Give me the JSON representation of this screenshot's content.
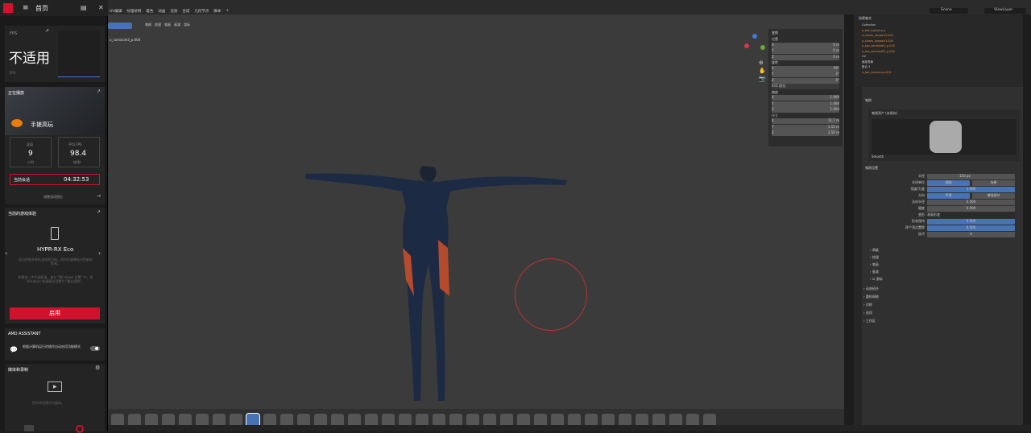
{
  "amd": {
    "title": "首页",
    "fps_label": "FPS",
    "fps_value": "不适用",
    "fps_label2": "FPS",
    "now_playing_label": "正在播放",
    "game_name": "手搓高玩",
    "stat1_label": "全局",
    "stat1_value": "9",
    "stat1_unit": "小时",
    "stat2_label": "平均 FPS",
    "stat2_value": "98.4",
    "stat2_unit": "帧/秒",
    "session_label": "当前会话",
    "session_value": "04:32:53",
    "adjust_label": "调整游戏图形",
    "current_exp_label": "当前的游戏体验",
    "hypr_title": "HYPR-RX Eco",
    "hypr_desc": "适当控制并降低游戏的功耗，同时尽量降低对性能的影响。",
    "hypr_desc2": "如需进一步节省能源，请在 \"Windows 设置\" 中，将 Windows 电源模式设置为 \"最长续航\"。",
    "enable_button": "启用",
    "assistant_label": "AMD ASSISTANT",
    "assistant_text": "根据计算机运行的操作自动启用功能模式",
    "media_label": "媒体和录制",
    "media_text": "您尚未创建任何媒体。"
  },
  "blender": {
    "menus": [
      "UV编辑",
      "纹理绘制",
      "着色",
      "动画",
      "渲染",
      "合成",
      "几何节点",
      "脚本"
    ],
    "scene": "Scene",
    "view_layer": "ViewLayer",
    "viewport_label": "o_camisole3_p.004",
    "header_buttons": [
      "笔刷",
      "纹理",
      "笔画",
      "衰减",
      "游标"
    ],
    "n_transform": "变换",
    "n_location": "位置",
    "n_loc": [
      "0 m",
      "0 m",
      "0 m"
    ],
    "n_rotation": "旋转",
    "n_rot": [
      "90°",
      "0°",
      "0°"
    ],
    "n_rot_mode": "XYZ 欧拉",
    "n_scale": "缩放",
    "n_scl": [
      "1.000",
      "1.000",
      "1.000"
    ],
    "n_dimensions": "尺寸",
    "n_dim": [
      "11.7 m",
      "1.15 m",
      "3.50 m"
    ],
    "axes": [
      "X",
      "Y",
      "Z"
    ],
    "outliner_title": "场景集合",
    "outliner_items": [
      "Collection",
      "o_bot_bonuma.p",
      "o_shoes_lowpart1.002",
      "o_shoes_lowpart1.004",
      "o_top_camisole1_p.010",
      "o_top_camisole3_p.004",
      "G2",
      "面部表情",
      "集合 3",
      "o_bot_bonuma.p.001"
    ],
    "brush_panel": "笔刷",
    "brush_asset": "笔刷资产 (未保存)",
    "brush_name": "Smooth",
    "brush_settings": "笔刷设置",
    "radius_label": "半径",
    "radius_value": "150 px",
    "radius_unit_label": "半径单位",
    "radius_unit_opts": [
      "视图",
      "场景"
    ],
    "strength_label": "强度/力度",
    "strength_value": "1.000",
    "direction_label": "方向",
    "direction_opts": [
      "平滑",
      "增强细节"
    ],
    "normal_radius_label": "法向半径",
    "normal_radius_value": "0.500",
    "hardness_label": "硬度",
    "hardness_value": "0.000",
    "deform_label": "变形",
    "deform_value": "表面形变",
    "shape_label": "形状保持",
    "shape_value": "0.500",
    "per_vertex_label": "逐个顶点置换",
    "per_vertex_value": "0.500",
    "iterations_label": "迭代",
    "iterations_value": "4",
    "sections": [
      "高级",
      "纹理",
      "笔画",
      "衰减"
    ],
    "cursor_section": "游标",
    "lower_sections": [
      "动态拓扑",
      "重构网格",
      "对称",
      "选项",
      "工作区"
    ]
  }
}
